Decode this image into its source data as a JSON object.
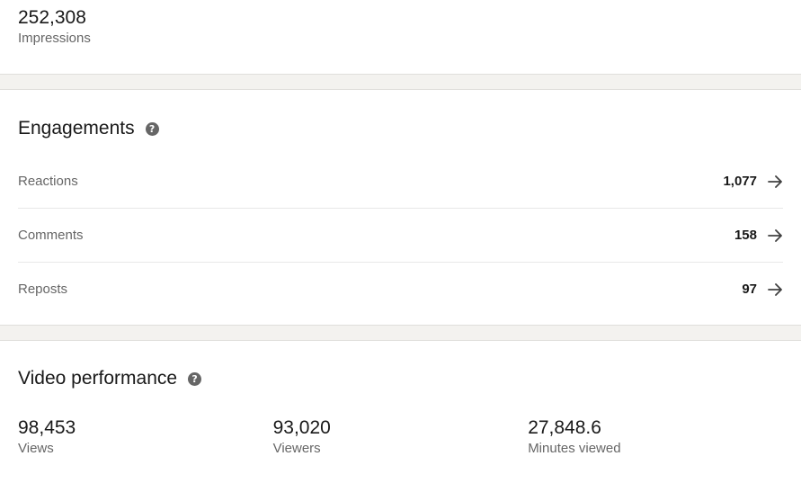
{
  "impressions": {
    "value": "252,308",
    "label": "Impressions"
  },
  "engagements": {
    "title": "Engagements",
    "help_icon": "question-circle-icon",
    "rows": [
      {
        "label": "Reactions",
        "value": "1,077",
        "icon": "arrow-right-icon"
      },
      {
        "label": "Comments",
        "value": "158",
        "icon": "arrow-right-icon"
      },
      {
        "label": "Reposts",
        "value": "97",
        "icon": "arrow-right-icon"
      }
    ]
  },
  "video_performance": {
    "title": "Video performance",
    "help_icon": "question-circle-icon",
    "metrics": [
      {
        "value": "98,453",
        "label": "Views"
      },
      {
        "value": "93,020",
        "label": "Viewers"
      },
      {
        "value": "27,848.6",
        "label": "Minutes viewed"
      }
    ]
  },
  "colors": {
    "text_primary": "#191919",
    "text_secondary": "#666666",
    "divider_background": "#f3f2ef"
  }
}
